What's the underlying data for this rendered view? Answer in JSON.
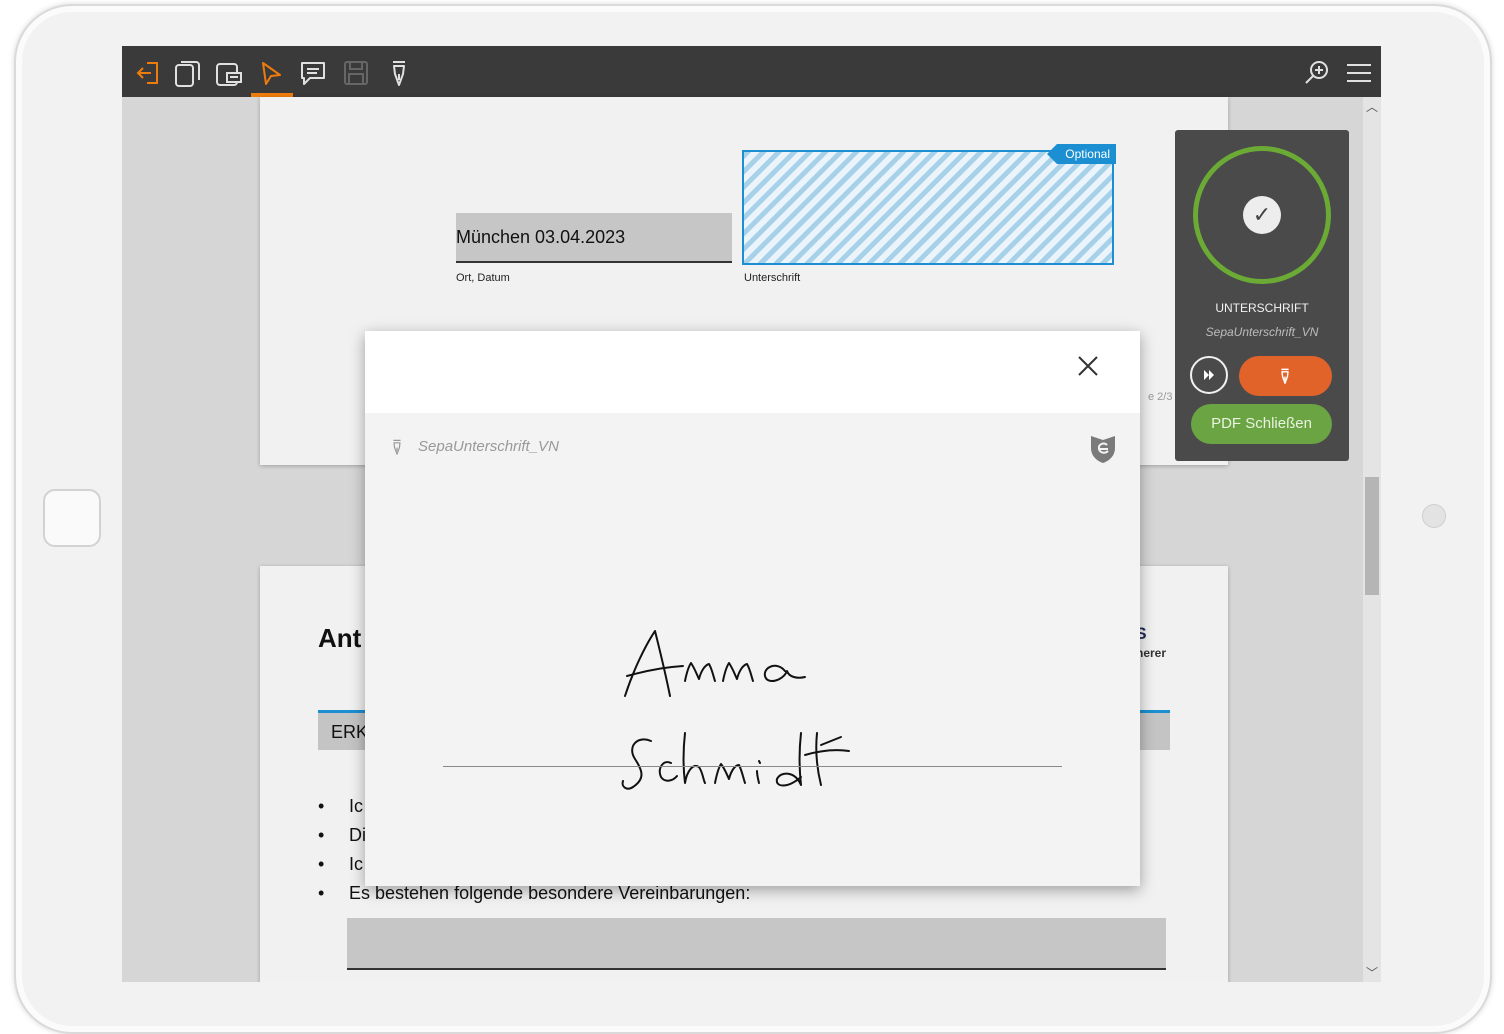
{
  "toolbar": {
    "icons": [
      "exit-icon",
      "pages-icon",
      "insert-icon",
      "select-pointer-icon",
      "comment-icon",
      "save-icon",
      "pen-icon",
      "zoom-icon",
      "menu-icon"
    ]
  },
  "page1": {
    "date_value": "München 03.04.2023",
    "date_label": "Ort, Datum",
    "signature_label": "Unterschrift",
    "optional_tag": "Optional",
    "page_indicator": "e 2/3"
  },
  "side_panel": {
    "title": "UNTERSCHRIFT",
    "subtitle": "SepaUnterschrift_VN",
    "pdf_close": "PDF Schließen",
    "ring_color": "#6aaa35"
  },
  "page2": {
    "heading": "Ant",
    "logo_text": "US",
    "logo_sub": "nerer",
    "section_title": "ERK",
    "bullets": [
      "Ic",
      "Di",
      "Ic",
      "Es bestehen folgende besondere Vereinbarungen:"
    ]
  },
  "dialog": {
    "signature_name": "SepaUnterschrift_VN",
    "handwriting_line1": "Anna",
    "handwriting_line2": "Schmidt"
  },
  "colors": {
    "accent": "#ee7c0d",
    "toolbar_bg": "#3a3a3a",
    "signature_field": "#1b8fd1",
    "sign_button": "#e2632a",
    "pdf_button": "#6aa443"
  }
}
